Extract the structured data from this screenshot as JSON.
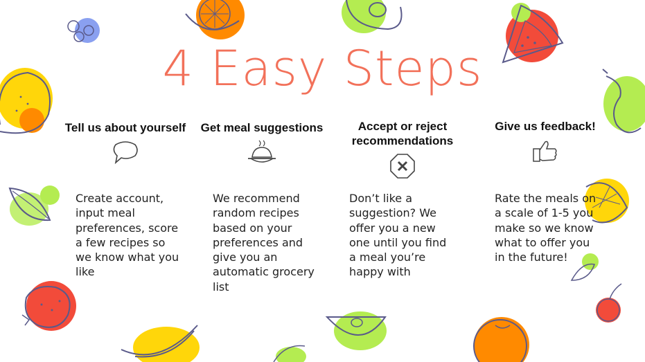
{
  "title": "4 Easy Steps",
  "steps": [
    {
      "title": "Tell us about yourself",
      "body": "Create account, input meal preferences, score a few recipes so we know what you like",
      "icon": "speech-bubble-icon"
    },
    {
      "title": "Get meal suggestions",
      "body": "We recommend random recipes based on your preferences and give you an automatic grocery list",
      "icon": "food-dish-icon"
    },
    {
      "title": "Accept or reject recommendations",
      "body": "Don’t like a suggestion? We offer you a new one until you find a meal you’re happy with",
      "icon": "reject-octagon-icon"
    },
    {
      "title": "Give us feedback!",
      "body": "Rate the meals on a scale of 1-5 you make so we know what to offer you in the future!",
      "icon": "thumbs-up-icon"
    }
  ],
  "colors": {
    "accent": "#f2715a",
    "yellow": "#ffd60a",
    "lime": "#b4ec51",
    "orange": "#ff8a00",
    "red": "#f24b3a",
    "blue": "#8aa0f0"
  }
}
